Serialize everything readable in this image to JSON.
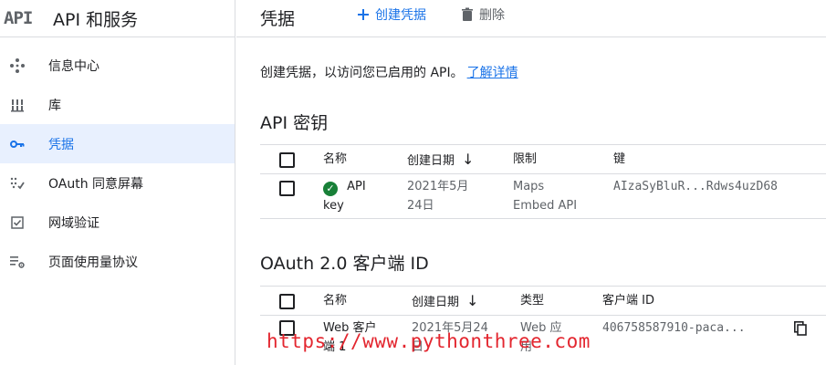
{
  "sidebar": {
    "logo": "API",
    "title": "API 和服务",
    "items": [
      {
        "label": "信息中心",
        "icon": "dashboard-diamond-icon"
      },
      {
        "label": "库",
        "icon": "library-icon"
      },
      {
        "label": "凭据",
        "icon": "key-icon",
        "active": true
      },
      {
        "label": "OAuth 同意屏幕",
        "icon": "consent-icon"
      },
      {
        "label": "网域验证",
        "icon": "checkbox-verify-icon"
      },
      {
        "label": "页面使用量协议",
        "icon": "settings-list-icon"
      }
    ]
  },
  "header": {
    "title": "凭据",
    "create_label": "创建凭据",
    "delete_label": "删除"
  },
  "intro": {
    "text": "创建凭据，以访问您已启用的 API。",
    "link": "了解详情"
  },
  "api_keys": {
    "title": "API 密钥",
    "columns": [
      "名称",
      "创建日期",
      "限制",
      "键"
    ],
    "rows": [
      {
        "name_line1": "API",
        "name_line2": "key",
        "date_line1": "2021年5月",
        "date_line2": "24日",
        "restriction_line1": "Maps",
        "restriction_line2": "Embed API",
        "key": "AIzaSyBluR...Rdws4uzD68"
      }
    ]
  },
  "oauth": {
    "title": "OAuth 2.0 客户端 ID",
    "columns": [
      "名称",
      "创建日期",
      "类型",
      "客户端 ID"
    ],
    "rows": [
      {
        "name_line1": "Web 客户",
        "name_line2": "端 1",
        "date_line1": "2021年5月24",
        "date_line2": "日",
        "type_line1": "Web 应",
        "type_line2": "用",
        "client_id": "406758587910-paca..."
      }
    ]
  },
  "watermark": "https://www.pythonthree.com",
  "colors": {
    "accent": "#1a73e8",
    "active_bg": "#e8f0fe",
    "ok": "#188038",
    "watermark": "#e3262f"
  }
}
